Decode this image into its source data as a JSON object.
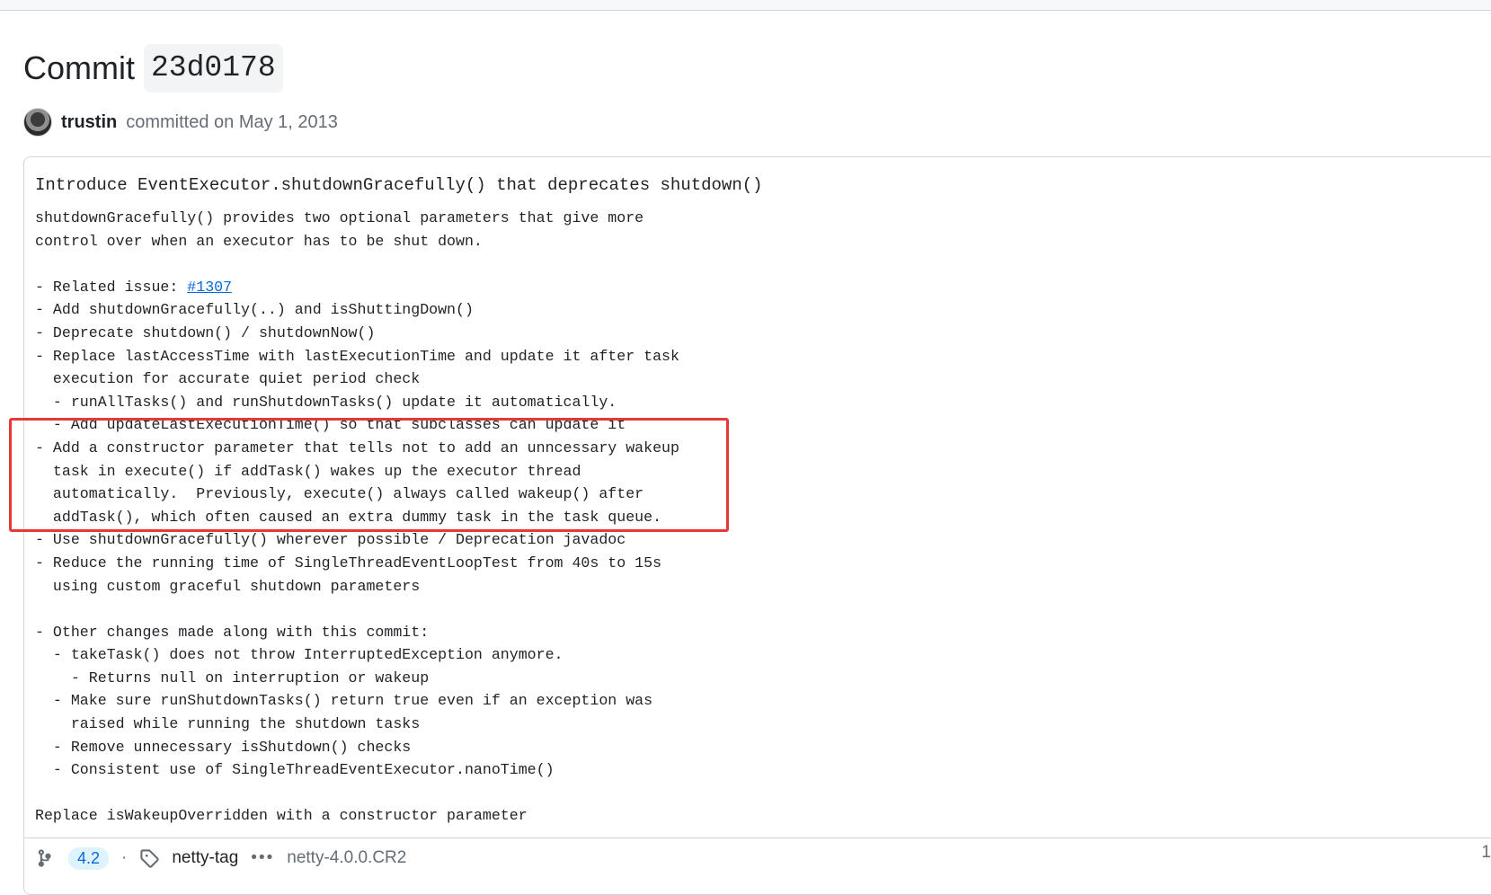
{
  "header": {
    "title_prefix": "Commit",
    "sha": "23d0178",
    "author": "trustin",
    "committed_text": "committed on May 1, 2013"
  },
  "message": {
    "headline": "Introduce EventExecutor.shutdownGracefully() that deprecates shutdown()",
    "lines": [
      "shutdownGracefully() provides two optional parameters that give more",
      "control over when an executor has to be shut down.",
      "",
      "- Related issue: ",
      "- Add shutdownGracefully(..) and isShuttingDown()",
      "- Deprecate shutdown() / shutdownNow()",
      "- Replace lastAccessTime with lastExecutionTime and update it after task",
      "  execution for accurate quiet period check",
      "  - runAllTasks() and runShutdownTasks() update it automatically.",
      "  - Add updateLastExecutionTime() so that subclasses can update it",
      "- Add a constructor parameter that tells not to add an unncessary wakeup",
      "  task in execute() if addTask() wakes up the executor thread",
      "  automatically.  Previously, execute() always called wakeup() after",
      "  addTask(), which often caused an extra dummy task in the task queue.",
      "- Use shutdownGracefully() wherever possible / Deprecation javadoc",
      "- Reduce the running time of SingleThreadEventLoopTest from 40s to 15s",
      "  using custom graceful shutdown parameters",
      "",
      "- Other changes made along with this commit:",
      "  - takeTask() does not throw InterruptedException anymore.",
      "    - Returns null on interruption or wakeup",
      "  - Make sure runShutdownTasks() return true even if an exception was",
      "    raised while running the shutdown tasks",
      "  - Remove unnecessary isShutdown() checks",
      "  - Consistent use of SingleThreadEventExecutor.nanoTime()",
      "",
      "Replace isWakeupOverridden with a constructor parameter"
    ],
    "issue_link": "#1307"
  },
  "footer": {
    "branch_pill": "4.2",
    "tag_name": "netty-tag",
    "dots": "•••",
    "last_tag": "netty-4.0.0.CR2",
    "right_number": "1"
  },
  "colors": {
    "link": "#0969da",
    "highlight_border": "#e53935",
    "border": "#d0d7de"
  }
}
